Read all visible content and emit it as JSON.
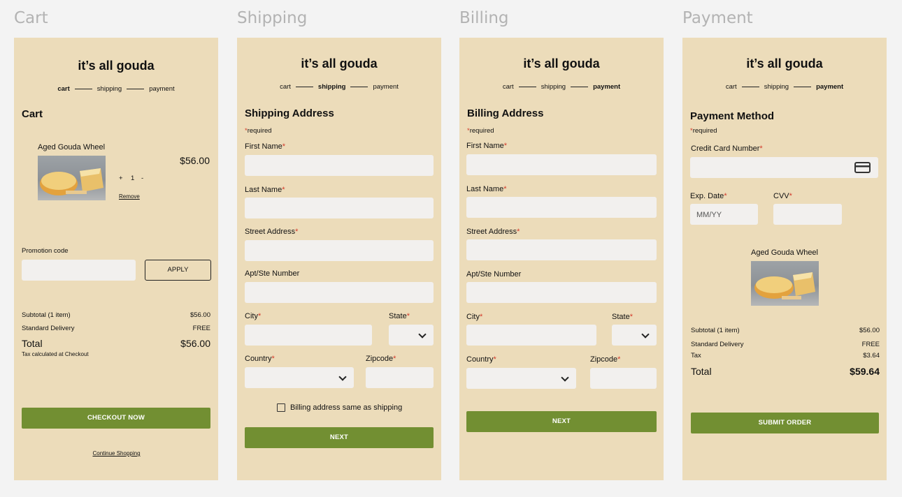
{
  "frames": {
    "cart": "Cart",
    "shipping": "Shipping",
    "billing": "Billing",
    "payment": "Payment"
  },
  "brand": "it’s all gouda",
  "steps": [
    "cart",
    "shipping",
    "payment"
  ],
  "required_note": "required",
  "cart": {
    "heading": "Cart",
    "item_name": "Aged Gouda Wheel",
    "price": "$56.00",
    "qty_plus": "+",
    "qty": "1",
    "qty_minus": "-",
    "remove": "Remove",
    "promo_label": "Promotion code",
    "apply": "APPLY",
    "subtotal_label": "Subtotal (1 item)",
    "subtotal": "$56.00",
    "delivery_label": "Standard Delivery",
    "delivery": "FREE",
    "total_label": "Total",
    "total": "$56.00",
    "tax_note": "Tax calculated at Checkout",
    "checkout": "CHECKOUT NOW",
    "continue": "Continue Shopping"
  },
  "shipping": {
    "heading": "Shipping Address",
    "first_name": "First Name",
    "last_name": "Last Name",
    "street": "Street Address",
    "apt": "Apt/Ste Number",
    "city": "City",
    "state": "State",
    "country": "Country",
    "zipcode": "Zipcode",
    "billing_same": "Billing address same as shipping",
    "next": "NEXT"
  },
  "billing": {
    "heading": "Billing Address",
    "first_name": "First Name",
    "last_name": "Last Name",
    "street": "Street Address",
    "apt": "Apt/Ste Number",
    "city": "City",
    "state": "State",
    "country": "Country",
    "zipcode": "Zipcode",
    "next": "NEXT"
  },
  "payment": {
    "heading": "Payment Method",
    "card_label": "Credit Card Number",
    "exp_label": "Exp. Date",
    "exp_placeholder": "MM/YY",
    "cvv_label": "CVV",
    "item_name": "Aged Gouda Wheel",
    "subtotal_label": "Subtotal (1 item)",
    "subtotal": "$56.00",
    "delivery_label": "Standard Delivery",
    "delivery": "FREE",
    "tax_label": "Tax",
    "tax": "$3.64",
    "total_label": "Total",
    "total": "$59.64",
    "submit": "SUBMIT ORDER"
  },
  "colors": {
    "panel": "#ecdcba",
    "accent_green": "#728f32",
    "required_red": "#d23a2a",
    "field": "#f2f0ee"
  }
}
